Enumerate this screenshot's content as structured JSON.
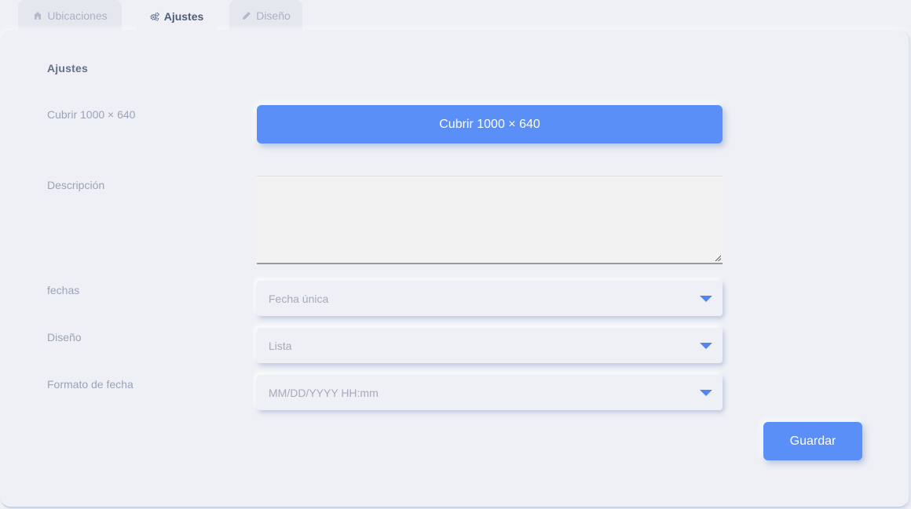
{
  "tabs": [
    {
      "label": "Ubicaciones",
      "icon": "home-icon"
    },
    {
      "label": "Ajustes",
      "icon": "cogs-icon"
    },
    {
      "label": "Diseño",
      "icon": "pencil-icon"
    }
  ],
  "active_tab": "Ajustes",
  "settings": {
    "title": "Ajustes",
    "cover_label": "Cubrir 1000 × 640",
    "cover_button": "Cubrir 1000 × 640",
    "description_label": "Descripción",
    "description_value": "",
    "dates_label": "fechas",
    "dates_value": "Fecha única",
    "layout_label": "Diseño",
    "layout_value": "Lista",
    "date_format_label": "Formato de fecha",
    "date_format_value": "MM/DD/YYYY HH:mm",
    "save_button": "Guardar"
  },
  "colors": {
    "accent": "#5a8ff7",
    "caret": "#4f86ef",
    "background": "#eef0f5"
  }
}
